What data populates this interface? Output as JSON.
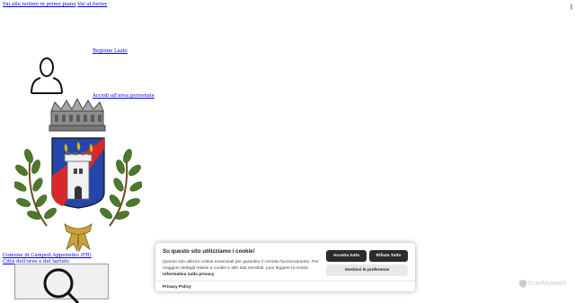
{
  "skip_links": {
    "main_news": "Vai alle notizie in primo piano",
    "footer": "Vai al footer"
  },
  "header": {
    "region_link": "Regione Lazio",
    "login_link": "Accedi all'area personale",
    "comune_name": "Comune di Campoli Appennino (FR)",
    "comune_tagline": "Città dell'orso e del tartufo"
  },
  "cookie_banner": {
    "title": "Su questo sito utilizziamo i cookie!",
    "text_line1": "Questo sito utilizza cookie essenziali per garantire il corretto funzionamento.",
    "text_line2": "Per maggiori dettagli relativi a cookie e altri dati sensibili, puoi leggere la nostra",
    "text_link": "informativa sulla privacy",
    "accept_label": "Accetta tutto",
    "reject_label": "Rifiuta Tutto",
    "prefs_label": "Gestisci le preferenze",
    "privacy_label": "Privacy Policy"
  },
  "watermark": "ScanMalware",
  "icons": [
    "user-icon",
    "coat-of-arms-icon",
    "search-icon",
    "shield-watermark-icon"
  ]
}
